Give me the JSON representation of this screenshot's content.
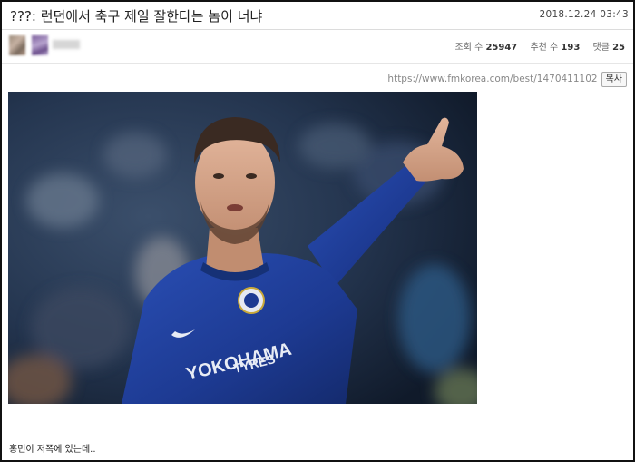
{
  "post": {
    "title": "???: 런던에서 축구 제일 잘한다는 놈이 너냐",
    "date": "2018.12.24 03:43"
  },
  "stats": {
    "views_label": "조회 수",
    "views": "25947",
    "recommend_label": "추천 수",
    "recommend": "193",
    "comments_label": "댓글",
    "comments": "25"
  },
  "link": {
    "url": "https://www.fmkorea.com/best/1470411102",
    "copy_label": "복사"
  },
  "image": {
    "sponsor_text_line1": "YOKOHAMA",
    "sponsor_text_line2": "TYRES",
    "jersey_color": "#1f3f9e",
    "background_color": "#22344f"
  },
  "body": {
    "text": "홍민이 저쪽에 있는데.."
  }
}
